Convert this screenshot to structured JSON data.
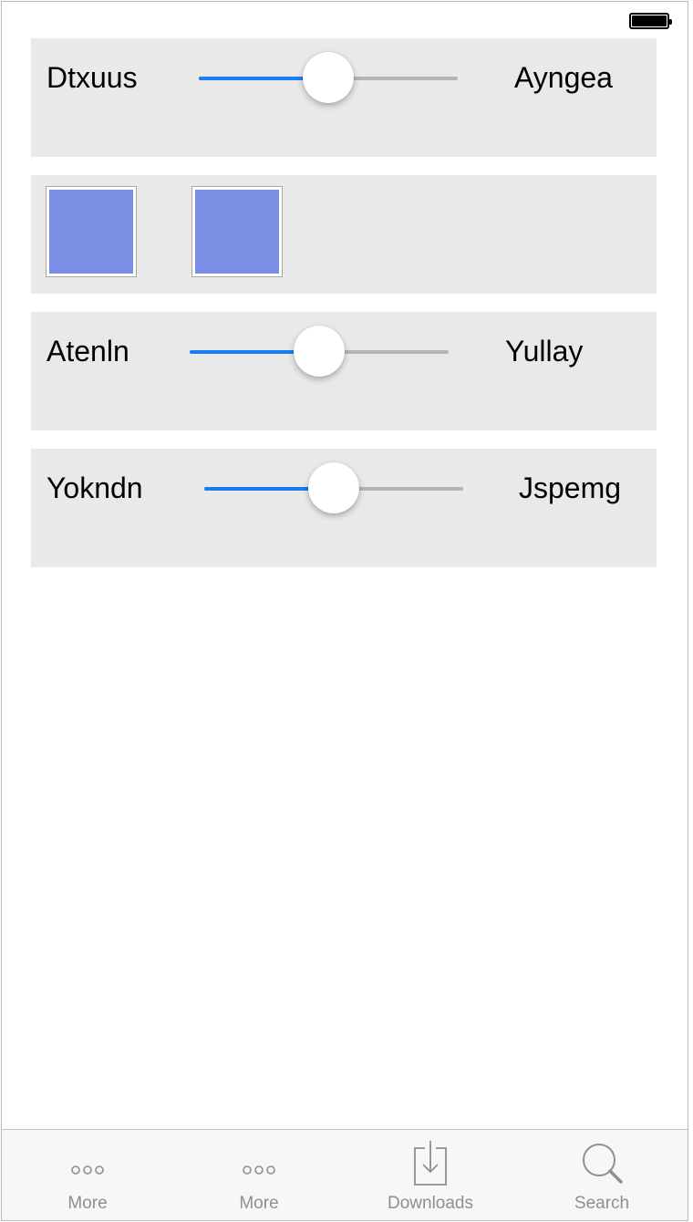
{
  "status_bar": {
    "battery_icon": "battery-full-icon"
  },
  "rows": [
    {
      "type": "slider",
      "left_label": "Dtxuus",
      "right_label": "Ayngea",
      "value": 0.5
    },
    {
      "type": "swatches",
      "colors": [
        "#7a8fe4",
        "#7a8fe4"
      ]
    },
    {
      "type": "slider",
      "left_label": "Atenln",
      "right_label": "Yullay",
      "value": 0.5
    },
    {
      "type": "slider",
      "left_label": "Yokndn",
      "right_label": "Jspemg",
      "value": 0.5
    }
  ],
  "tabbar": {
    "tabs": [
      {
        "label": "More",
        "icon": "more-icon"
      },
      {
        "label": "More",
        "icon": "more-icon"
      },
      {
        "label": "Downloads",
        "icon": "downloads-icon"
      },
      {
        "label": "Search",
        "icon": "search-icon"
      }
    ]
  },
  "colors": {
    "accent": "#1a7cf0",
    "track": "#b5b5b5",
    "panel": "#e9e9e9",
    "tab_icon": "#8e8e93"
  }
}
